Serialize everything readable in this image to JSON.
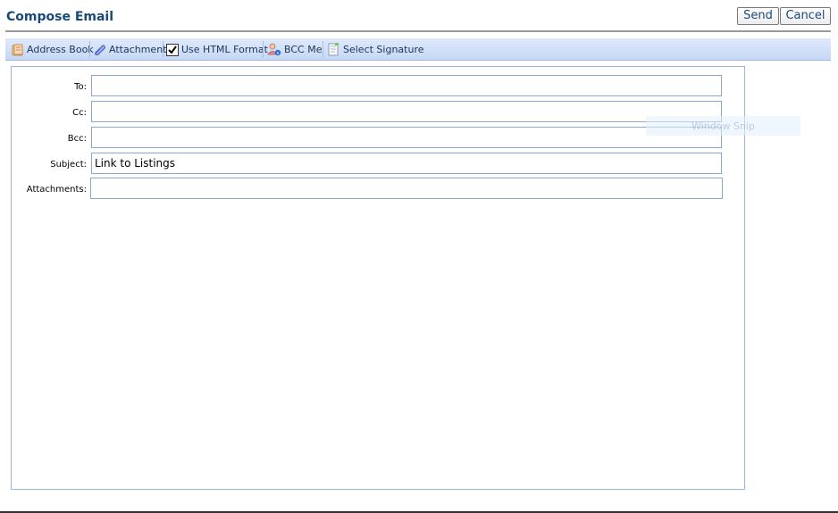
{
  "window": {
    "title": "Compose Email",
    "send_label": "Send",
    "cancel_label": "Cancel"
  },
  "toolbar": {
    "address_book": "Address Book",
    "attachment": "Attachment",
    "use_html_format": "Use HTML Format",
    "use_html_format_checked": true,
    "bcc_me": "BCC Me",
    "select_signature": "Select Signature"
  },
  "form": {
    "to_label": "To:",
    "cc_label": "Cc:",
    "bcc_label": "Bcc:",
    "subject_label": "Subject:",
    "attachments_label": "Attachments:",
    "to_value": "",
    "cc_value": "",
    "bcc_value": "",
    "subject_value": "Link to Listings",
    "attachments_value": ""
  },
  "overlay": {
    "snip_text": "Window Snip"
  },
  "colors": {
    "title": "#1a4a7a",
    "toolbar_top": "#dfe9fb",
    "toolbar_bottom": "#c7d8f5",
    "field_border": "#8aa8cc"
  }
}
